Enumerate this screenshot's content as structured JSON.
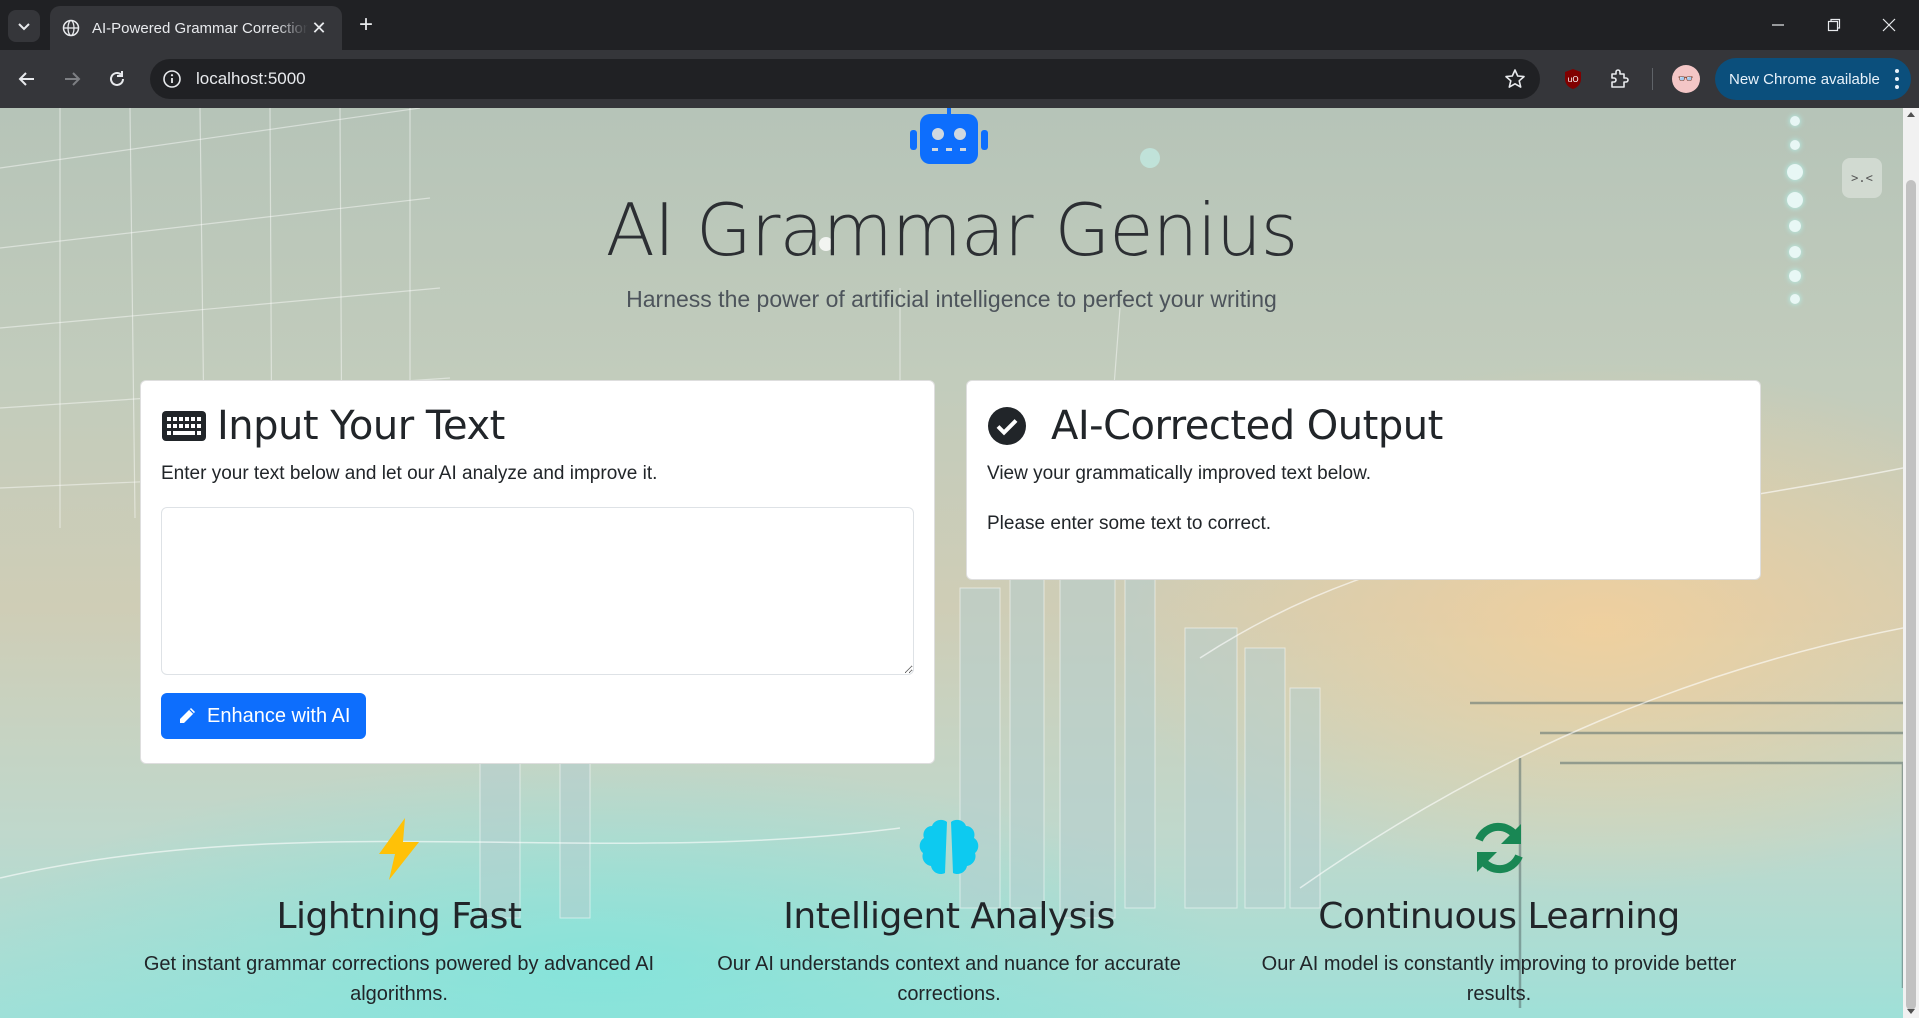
{
  "browser": {
    "tab_title": "AI-Powered Grammar Correction",
    "url": "localhost:5000",
    "update_label": "New Chrome available"
  },
  "page": {
    "title": "AI Grammar Genius",
    "subtitle": "Harness the power of artificial intelligence to perfect your writing",
    "input_card": {
      "heading": "Input Your Text",
      "description": "Enter your text below and let our AI analyze and improve it.",
      "textarea_value": "",
      "button_label": "Enhance with AI"
    },
    "output_card": {
      "heading": "AI-Corrected Output",
      "description": "View your grammatically improved text below.",
      "result": "Please enter some text to correct."
    },
    "features": [
      {
        "icon": "bolt-icon",
        "title": "Lightning Fast",
        "text": "Get instant grammar corrections powered by advanced AI algorithms."
      },
      {
        "icon": "brain-icon",
        "title": "Intelligent Analysis",
        "text": "Our AI understands context and nuance for accurate corrections."
      },
      {
        "icon": "sync-icon",
        "title": "Continuous Learning",
        "text": "Our AI model is constantly improving to provide better results."
      }
    ]
  },
  "colors": {
    "primary": "#0d6efd",
    "bolt": "#ffc107",
    "brain": "#0dcaf0",
    "sync": "#198754",
    "heading": "#212529"
  }
}
